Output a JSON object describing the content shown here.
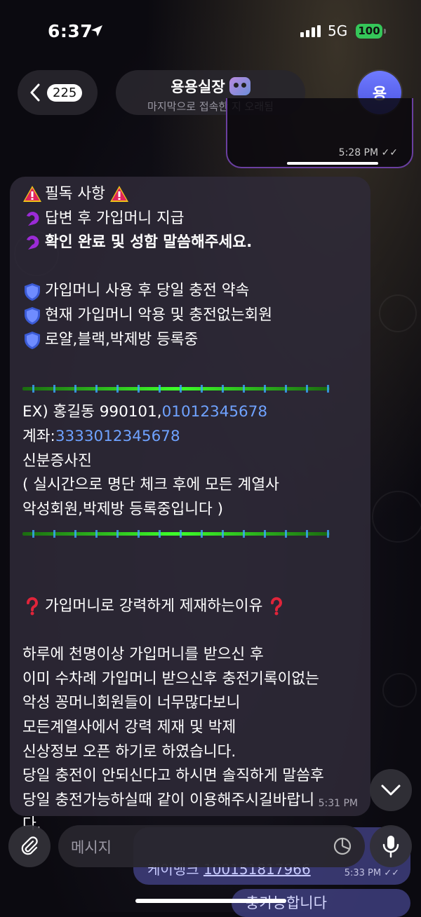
{
  "status": {
    "time": "6:37",
    "network": "5G",
    "battery": "100"
  },
  "header": {
    "back_count": "225",
    "chat_name": "용용실장",
    "chat_status": "마지막으로 접속한 지 오래됨",
    "avatar_letter": "용"
  },
  "prev_message": {
    "time": "5:28 PM"
  },
  "message": {
    "time": "5:31 PM",
    "lines": [
      {
        "type": "text",
        "icon": "warning-icon",
        "icon_after": "warning-icon",
        "text": "필독 사항"
      },
      {
        "type": "text",
        "icon": "pointing-hand-icon",
        "text": " 답변 후 가입머니 지급"
      },
      {
        "type": "text",
        "icon": "pointing-hand-icon",
        "text": "확인 완료 및 성함 말씀해주세요.",
        "bold": true
      },
      {
        "type": "blank"
      },
      {
        "type": "text",
        "icon": "shield-icon",
        "text": "가입머니 사용 후 당일 충전 약속"
      },
      {
        "type": "text",
        "icon": "shield-icon",
        "text": "현재 가입머니 악용 및 충전없는회원"
      },
      {
        "type": "text",
        "icon": "shield-icon",
        "text": "로얄,블랙,박제방 등록중"
      },
      {
        "type": "blank"
      },
      {
        "type": "divider"
      },
      {
        "type": "mixed",
        "text": "EX) 홍길동 990101,",
        "link": "01012345678"
      },
      {
        "type": "mixed",
        "text": "계좌:",
        "link": "3333012345678"
      },
      {
        "type": "text",
        "text": "신분증사진"
      },
      {
        "type": "text",
        "text": "( 실시간으로 명단 체크 후에 모든 계열사"
      },
      {
        "type": "text",
        "text": "악성회원,박제방 등록중입니다 )"
      },
      {
        "type": "divider"
      },
      {
        "type": "blank"
      },
      {
        "type": "blank"
      },
      {
        "type": "text",
        "icon": "question-icon",
        "icon_after": "question-icon",
        "text": "가입머니로 강력하게 제재하는이유 "
      },
      {
        "type": "blank"
      },
      {
        "type": "text",
        "text": "하루에 천명이상 가입머니를 받으신 후"
      },
      {
        "type": "text",
        "text": "이미 수차례 가입머니 받으신후 충전기록이없는"
      },
      {
        "type": "text",
        "text": "악성 꽁머니회원들이 너무많다보니"
      },
      {
        "type": "text",
        "text": "모든계열사에서 강력 제재 및 박제"
      },
      {
        "type": "text",
        "text": "신상정보 오픈 하기로 하였습니다."
      },
      {
        "type": "text",
        "text": "당일 충전이 안되신다고 하시면 솔직하게 말씀후"
      },
      {
        "type": "text",
        "text": "당일 충전가능하실때 같이 이용해주시길바랍니"
      },
      {
        "type": "text",
        "text": "다."
      }
    ]
  },
  "peek": {
    "line1_prefix": "케이뱅크 ",
    "line1_link": "100151817966",
    "line1_time": "5:33 PM",
    "line2": "충가능합니다"
  },
  "composer": {
    "placeholder": "메시지"
  },
  "colors": {
    "accent": "#6f7bff",
    "link": "#6fa2ff",
    "bubble": "#2e2a38",
    "outgoing_border": "#6a3fa0"
  }
}
